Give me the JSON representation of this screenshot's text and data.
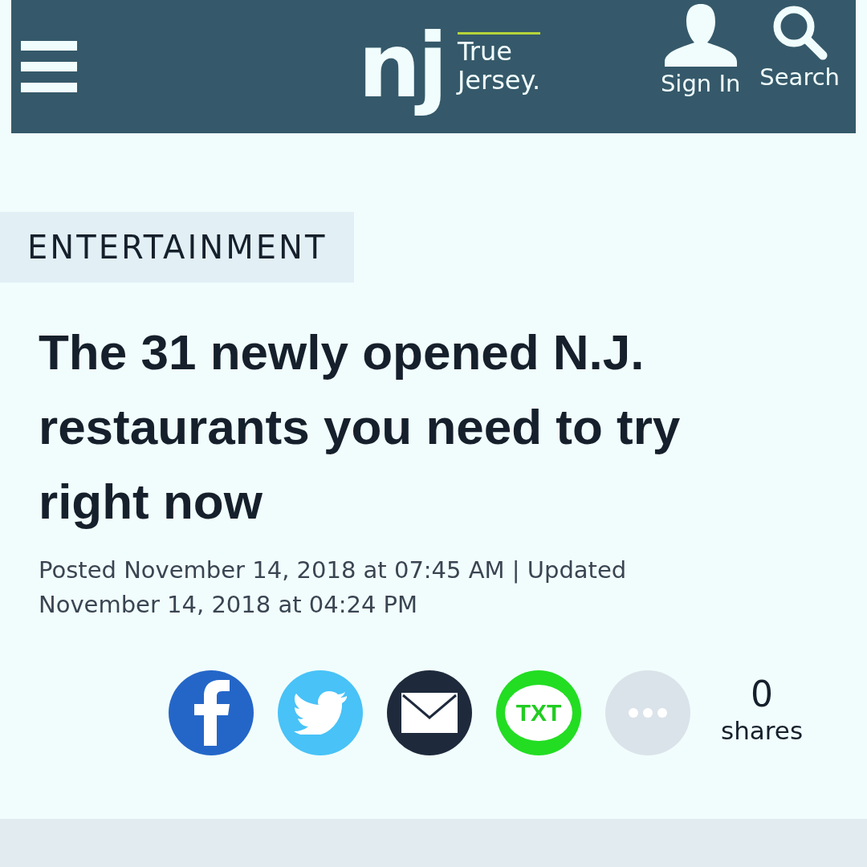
{
  "header": {
    "logo": "nj",
    "tagline": [
      "True",
      "Jersey."
    ],
    "actions": [
      {
        "kind": "user",
        "label": "Sign In"
      },
      {
        "kind": "search",
        "label": "Search"
      }
    ]
  },
  "section": "ENTERTAINMENT",
  "headline": "The 31 newly opened N.J. restaurants you need to try right now",
  "byline": "Posted November 14, 2018 at 07:45 AM | Updated November 14, 2018 at 04:24 PM",
  "share": {
    "buttons": [
      {
        "kind": "facebook"
      },
      {
        "kind": "twitter"
      },
      {
        "kind": "email"
      },
      {
        "kind": "text",
        "label": "TXT"
      },
      {
        "kind": "more"
      }
    ],
    "count": "0",
    "count_label": "shares"
  }
}
